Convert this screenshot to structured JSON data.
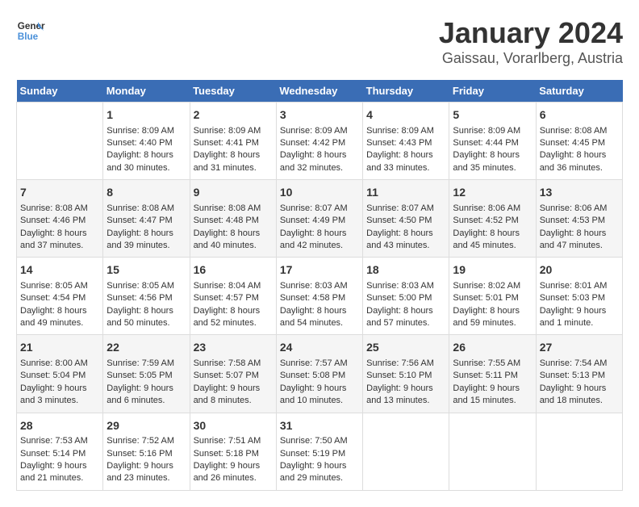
{
  "logo": {
    "text_general": "General",
    "text_blue": "Blue"
  },
  "title": "January 2024",
  "subtitle": "Gaissau, Vorarlberg, Austria",
  "weekdays": [
    "Sunday",
    "Monday",
    "Tuesday",
    "Wednesday",
    "Thursday",
    "Friday",
    "Saturday"
  ],
  "weeks": [
    [
      {
        "day": "",
        "content": ""
      },
      {
        "day": "1",
        "content": "Sunrise: 8:09 AM\nSunset: 4:40 PM\nDaylight: 8 hours\nand 30 minutes."
      },
      {
        "day": "2",
        "content": "Sunrise: 8:09 AM\nSunset: 4:41 PM\nDaylight: 8 hours\nand 31 minutes."
      },
      {
        "day": "3",
        "content": "Sunrise: 8:09 AM\nSunset: 4:42 PM\nDaylight: 8 hours\nand 32 minutes."
      },
      {
        "day": "4",
        "content": "Sunrise: 8:09 AM\nSunset: 4:43 PM\nDaylight: 8 hours\nand 33 minutes."
      },
      {
        "day": "5",
        "content": "Sunrise: 8:09 AM\nSunset: 4:44 PM\nDaylight: 8 hours\nand 35 minutes."
      },
      {
        "day": "6",
        "content": "Sunrise: 8:08 AM\nSunset: 4:45 PM\nDaylight: 8 hours\nand 36 minutes."
      }
    ],
    [
      {
        "day": "7",
        "content": "Sunrise: 8:08 AM\nSunset: 4:46 PM\nDaylight: 8 hours\nand 37 minutes."
      },
      {
        "day": "8",
        "content": "Sunrise: 8:08 AM\nSunset: 4:47 PM\nDaylight: 8 hours\nand 39 minutes."
      },
      {
        "day": "9",
        "content": "Sunrise: 8:08 AM\nSunset: 4:48 PM\nDaylight: 8 hours\nand 40 minutes."
      },
      {
        "day": "10",
        "content": "Sunrise: 8:07 AM\nSunset: 4:49 PM\nDaylight: 8 hours\nand 42 minutes."
      },
      {
        "day": "11",
        "content": "Sunrise: 8:07 AM\nSunset: 4:50 PM\nDaylight: 8 hours\nand 43 minutes."
      },
      {
        "day": "12",
        "content": "Sunrise: 8:06 AM\nSunset: 4:52 PM\nDaylight: 8 hours\nand 45 minutes."
      },
      {
        "day": "13",
        "content": "Sunrise: 8:06 AM\nSunset: 4:53 PM\nDaylight: 8 hours\nand 47 minutes."
      }
    ],
    [
      {
        "day": "14",
        "content": "Sunrise: 8:05 AM\nSunset: 4:54 PM\nDaylight: 8 hours\nand 49 minutes."
      },
      {
        "day": "15",
        "content": "Sunrise: 8:05 AM\nSunset: 4:56 PM\nDaylight: 8 hours\nand 50 minutes."
      },
      {
        "day": "16",
        "content": "Sunrise: 8:04 AM\nSunset: 4:57 PM\nDaylight: 8 hours\nand 52 minutes."
      },
      {
        "day": "17",
        "content": "Sunrise: 8:03 AM\nSunset: 4:58 PM\nDaylight: 8 hours\nand 54 minutes."
      },
      {
        "day": "18",
        "content": "Sunrise: 8:03 AM\nSunset: 5:00 PM\nDaylight: 8 hours\nand 57 minutes."
      },
      {
        "day": "19",
        "content": "Sunrise: 8:02 AM\nSunset: 5:01 PM\nDaylight: 8 hours\nand 59 minutes."
      },
      {
        "day": "20",
        "content": "Sunrise: 8:01 AM\nSunset: 5:03 PM\nDaylight: 9 hours\nand 1 minute."
      }
    ],
    [
      {
        "day": "21",
        "content": "Sunrise: 8:00 AM\nSunset: 5:04 PM\nDaylight: 9 hours\nand 3 minutes."
      },
      {
        "day": "22",
        "content": "Sunrise: 7:59 AM\nSunset: 5:05 PM\nDaylight: 9 hours\nand 6 minutes."
      },
      {
        "day": "23",
        "content": "Sunrise: 7:58 AM\nSunset: 5:07 PM\nDaylight: 9 hours\nand 8 minutes."
      },
      {
        "day": "24",
        "content": "Sunrise: 7:57 AM\nSunset: 5:08 PM\nDaylight: 9 hours\nand 10 minutes."
      },
      {
        "day": "25",
        "content": "Sunrise: 7:56 AM\nSunset: 5:10 PM\nDaylight: 9 hours\nand 13 minutes."
      },
      {
        "day": "26",
        "content": "Sunrise: 7:55 AM\nSunset: 5:11 PM\nDaylight: 9 hours\nand 15 minutes."
      },
      {
        "day": "27",
        "content": "Sunrise: 7:54 AM\nSunset: 5:13 PM\nDaylight: 9 hours\nand 18 minutes."
      }
    ],
    [
      {
        "day": "28",
        "content": "Sunrise: 7:53 AM\nSunset: 5:14 PM\nDaylight: 9 hours\nand 21 minutes."
      },
      {
        "day": "29",
        "content": "Sunrise: 7:52 AM\nSunset: 5:16 PM\nDaylight: 9 hours\nand 23 minutes."
      },
      {
        "day": "30",
        "content": "Sunrise: 7:51 AM\nSunset: 5:18 PM\nDaylight: 9 hours\nand 26 minutes."
      },
      {
        "day": "31",
        "content": "Sunrise: 7:50 AM\nSunset: 5:19 PM\nDaylight: 9 hours\nand 29 minutes."
      },
      {
        "day": "",
        "content": ""
      },
      {
        "day": "",
        "content": ""
      },
      {
        "day": "",
        "content": ""
      }
    ]
  ]
}
